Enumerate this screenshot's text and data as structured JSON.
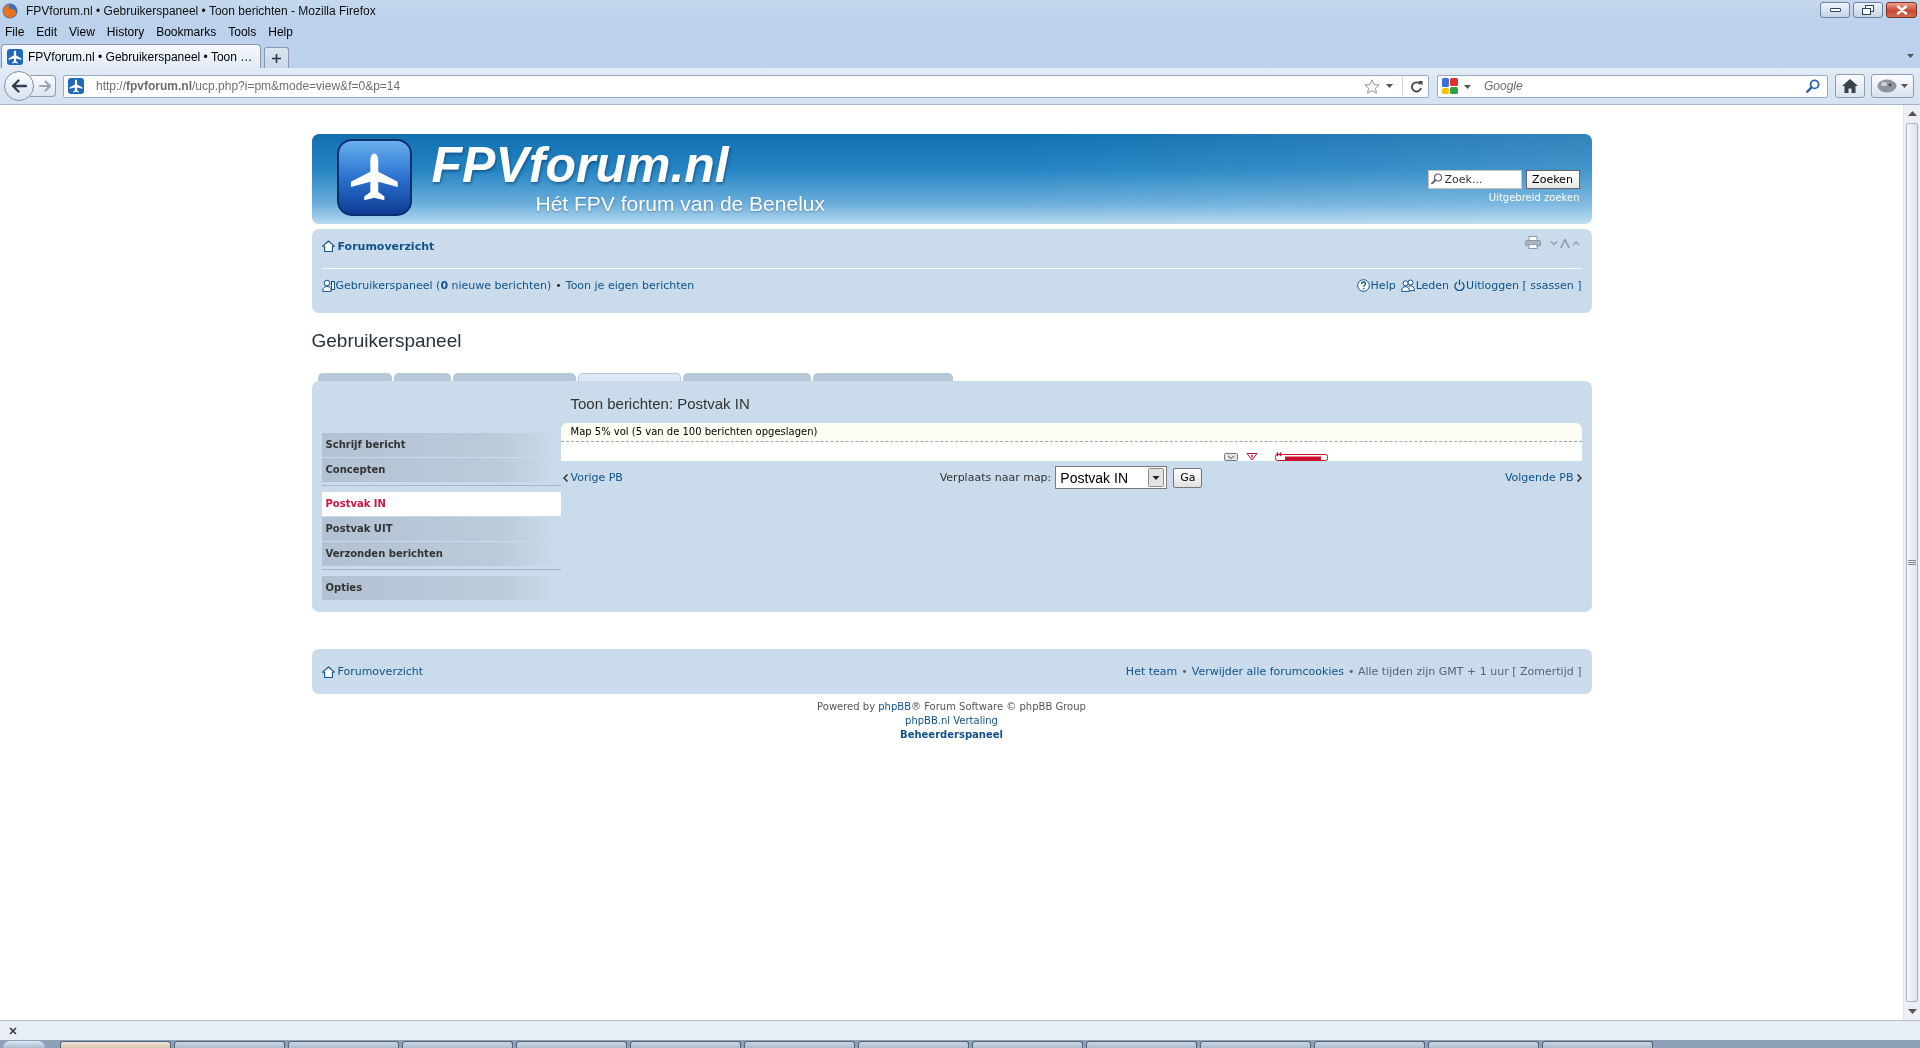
{
  "window": {
    "title": "FPVforum.nl • Gebruikerspaneel • Toon berichten - Mozilla Firefox"
  },
  "menu_bar": [
    "File",
    "Edit",
    "View",
    "History",
    "Bookmarks",
    "Tools",
    "Help"
  ],
  "tabs": [
    {
      "title": "FPVforum.nl • Gebruikerspaneel • Toon …",
      "selected": true
    }
  ],
  "address_bar": {
    "url": "http://**fpvforum.nl**/ucp.php?i=pm&mode=view&f=0&p=14"
  },
  "search_bar": {
    "placeholder": "Google"
  },
  "page": {
    "header": {
      "site_title": "FPVforum.nl",
      "tagline": "Hét FPV forum van de Benelux",
      "search": {
        "placeholder": "Zoek...",
        "button": "Zoeken"
      },
      "advanced_search": "Uitgebreid zoeken"
    },
    "navbar": {
      "breadcrumb": "Forumoverzicht",
      "left_links": [
        {
          "kind": "user",
          "text": "Gebruikerspaneel (**0** nieuwe berichten)"
        },
        {
          "kind": "separator",
          "text": "•"
        },
        {
          "kind": "link",
          "text": "Toon je eigen berichten"
        }
      ],
      "right_links": [
        {
          "kind": "help",
          "text": "Help"
        },
        {
          "kind": "members",
          "text": "Leden"
        },
        {
          "kind": "logout",
          "text": "Uitloggen [ ssassen ]"
        }
      ]
    },
    "heading": "Gebruikerspaneel",
    "ucp_tabs": [
      {
        "selected": false
      },
      {
        "selected": false
      },
      {
        "selected": false
      },
      {
        "selected": true
      },
      {
        "selected": false
      },
      {
        "selected": false
      }
    ],
    "sidebar": {
      "groups": [
        {
          "items": [
            {
              "label": "Schrijf bericht",
              "selected": false
            },
            {
              "label": "Concepten",
              "selected": false
            }
          ]
        },
        {
          "items": [
            {
              "label": "Postvak IN",
              "selected": true
            },
            {
              "label": "Postvak UIT",
              "selected": false
            },
            {
              "label": "Verzonden berichten",
              "selected": false
            }
          ]
        },
        {
          "items": [
            {
              "label": "Opties",
              "selected": false
            }
          ]
        }
      ]
    },
    "content": {
      "title": "Toon berichten: Postvak IN",
      "folder_usage": "Map 5% vol (5 van de 100 berichten opgeslagen)",
      "previous": "Vorige PB",
      "move_label": "Verplaats naar map:",
      "move_select": {
        "value": "Postvak IN"
      },
      "move_button": "Ga",
      "next": "Volgende PB"
    },
    "footer": {
      "home_link": "Forumoverzicht",
      "items": [
        {
          "kind": "link",
          "text": "Het team"
        },
        {
          "kind": "text",
          "text": "•"
        },
        {
          "kind": "link",
          "text": "Verwijder alle forumcookies"
        },
        {
          "kind": "text",
          "text": "• Alle tijden zijn GMT + 1 uur [ Zomertijd ]"
        }
      ]
    },
    "credits": {
      "powered_by": {
        "before": "Powered by ",
        "link": "phpBB",
        "after": "® Forum Software © phpBB Group"
      },
      "translation": "phpBB.nl Vertaling",
      "admin_link": "Beheerderspaneel"
    }
  },
  "taskbar": {
    "buttons": [
      {
        "selected": true
      },
      {
        "selected": false
      },
      {
        "selected": false
      },
      {
        "selected": false
      },
      {
        "selected": false
      },
      {
        "selected": false
      },
      {
        "selected": false
      },
      {
        "selected": false
      },
      {
        "selected": false
      },
      {
        "selected": false
      },
      {
        "selected": false
      },
      {
        "selected": false
      },
      {
        "selected": false
      },
      {
        "selected": false
      }
    ]
  }
}
